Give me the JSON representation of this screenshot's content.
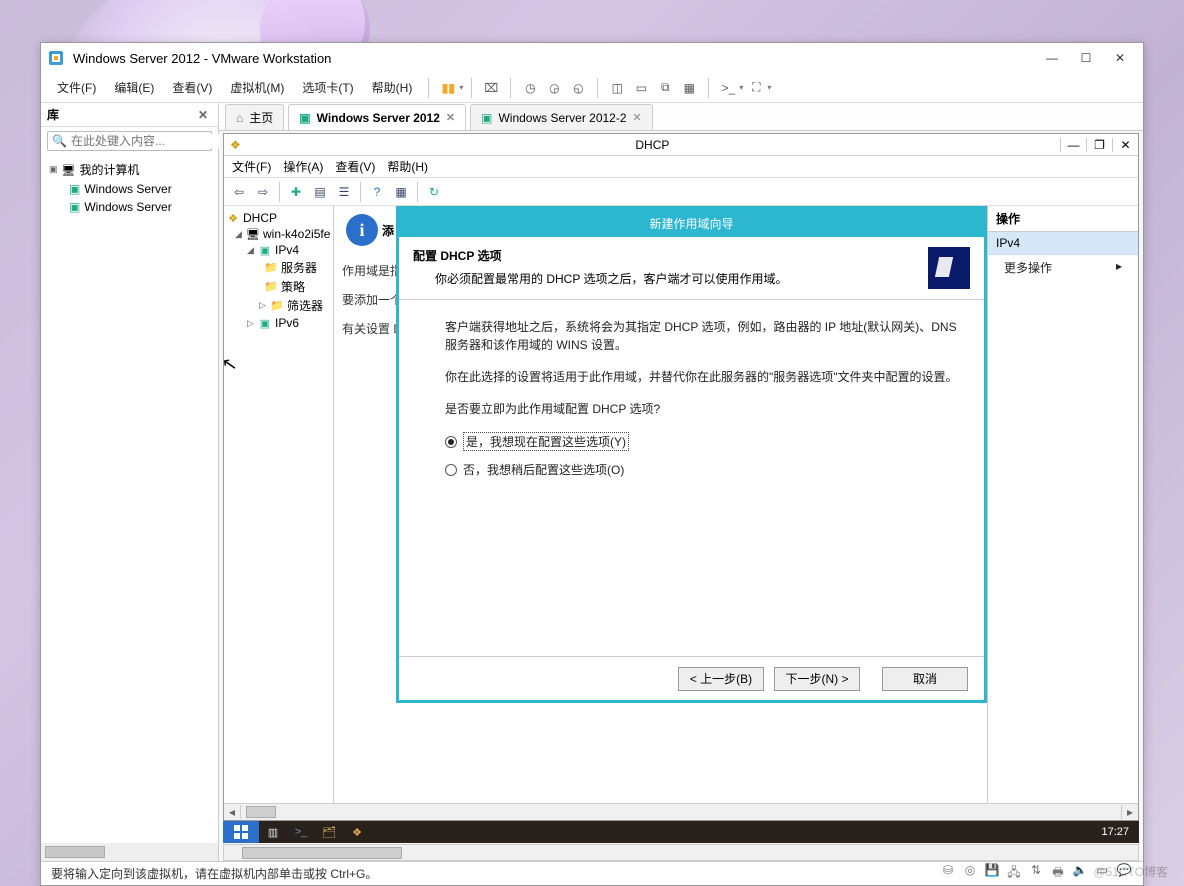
{
  "host": {
    "title": "Windows Server 2012 - VMware Workstation",
    "menus": [
      "文件(F)",
      "编辑(E)",
      "查看(V)",
      "虚拟机(M)",
      "选项卡(T)",
      "帮助(H)"
    ],
    "library": {
      "title": "库",
      "search_placeholder": "在此处键入内容...",
      "root": "我的计算机",
      "vms": [
        "Windows Server",
        "Windows Server"
      ]
    },
    "tabs": {
      "home": "主页",
      "items": [
        {
          "label": "Windows Server 2012",
          "active": true
        },
        {
          "label": "Windows Server 2012-2",
          "active": false
        }
      ]
    },
    "status": "要将输入定向到该虚拟机，请在虚拟机内部单击或按 Ctrl+G。"
  },
  "mmc": {
    "title": "DHCP",
    "menus": [
      "文件(F)",
      "操作(A)",
      "查看(V)",
      "帮助(H)"
    ],
    "tree": {
      "root": "DHCP",
      "server": "win-k4o2i5fe",
      "ipv4": "IPv4",
      "ipv4_children": [
        "服务器",
        "策略",
        "筛选器"
      ],
      "ipv6": "IPv6"
    },
    "center_partial": {
      "big": "添",
      "lines": [
        "作用域是指",
        "要添加一个",
        "有关设置 D"
      ]
    },
    "actions": {
      "header": "操作",
      "selected": "IPv4",
      "more": "更多操作"
    }
  },
  "wizard": {
    "title": "新建作用域向导",
    "header_main": "配置 DHCP 选项",
    "header_sub": "你必须配置最常用的 DHCP 选项之后，客户端才可以使用作用域。",
    "para1": "客户端获得地址之后，系统将会为其指定 DHCP 选项，例如，路由器的 IP 地址(默认网关)、DNS 服务器和该作用域的 WINS 设置。",
    "para2": "你在此选择的设置将适用于此作用域，并替代你在此服务器的\"服务器选项\"文件夹中配置的设置。",
    "question": "是否要立即为此作用域配置 DHCP 选项?",
    "opt_yes": "是，我想现在配置这些选项(Y)",
    "opt_no": "否，我想稍后配置这些选项(O)",
    "btn_back": "< 上一步(B)",
    "btn_next": "下一步(N) >",
    "btn_cancel": "取消"
  },
  "guest_taskbar": {
    "clock": "17:27"
  },
  "watermark": "@51CTO博客"
}
